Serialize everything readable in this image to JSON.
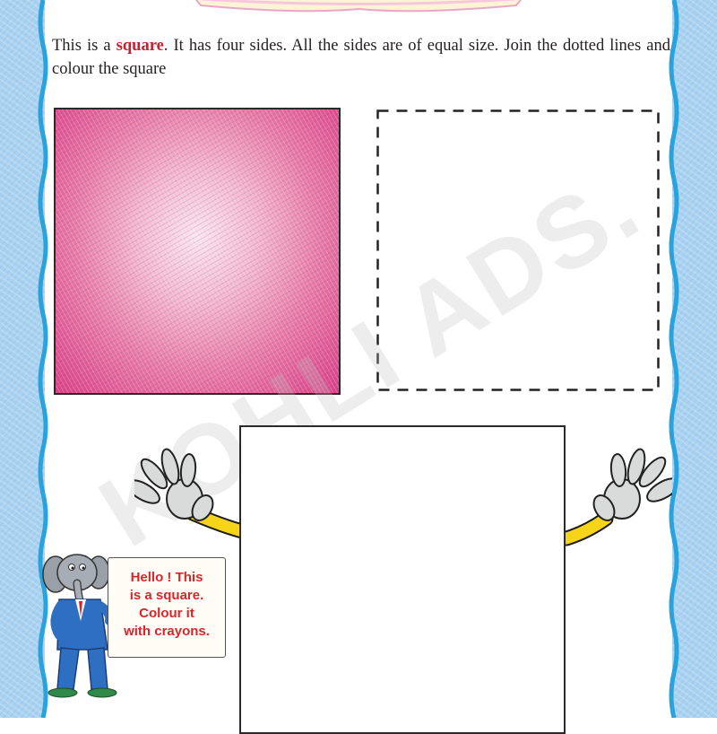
{
  "instructions": {
    "part1": "This is a ",
    "keyword": "square",
    "part2": ". It has four sides. All the sides are of equal size. Join the dotted lines and colour the square"
  },
  "watermark": "KOHLI ADS.",
  "speech_sign": {
    "lines": [
      "Hello ! This",
      "is a square.",
      "Colour it",
      "with crayons."
    ]
  },
  "colors": {
    "keyword_red": "#c8202e",
    "border_blue": "#a9d2f0",
    "square_pink": "#d84188",
    "sign_text_red": "#d7262c"
  }
}
